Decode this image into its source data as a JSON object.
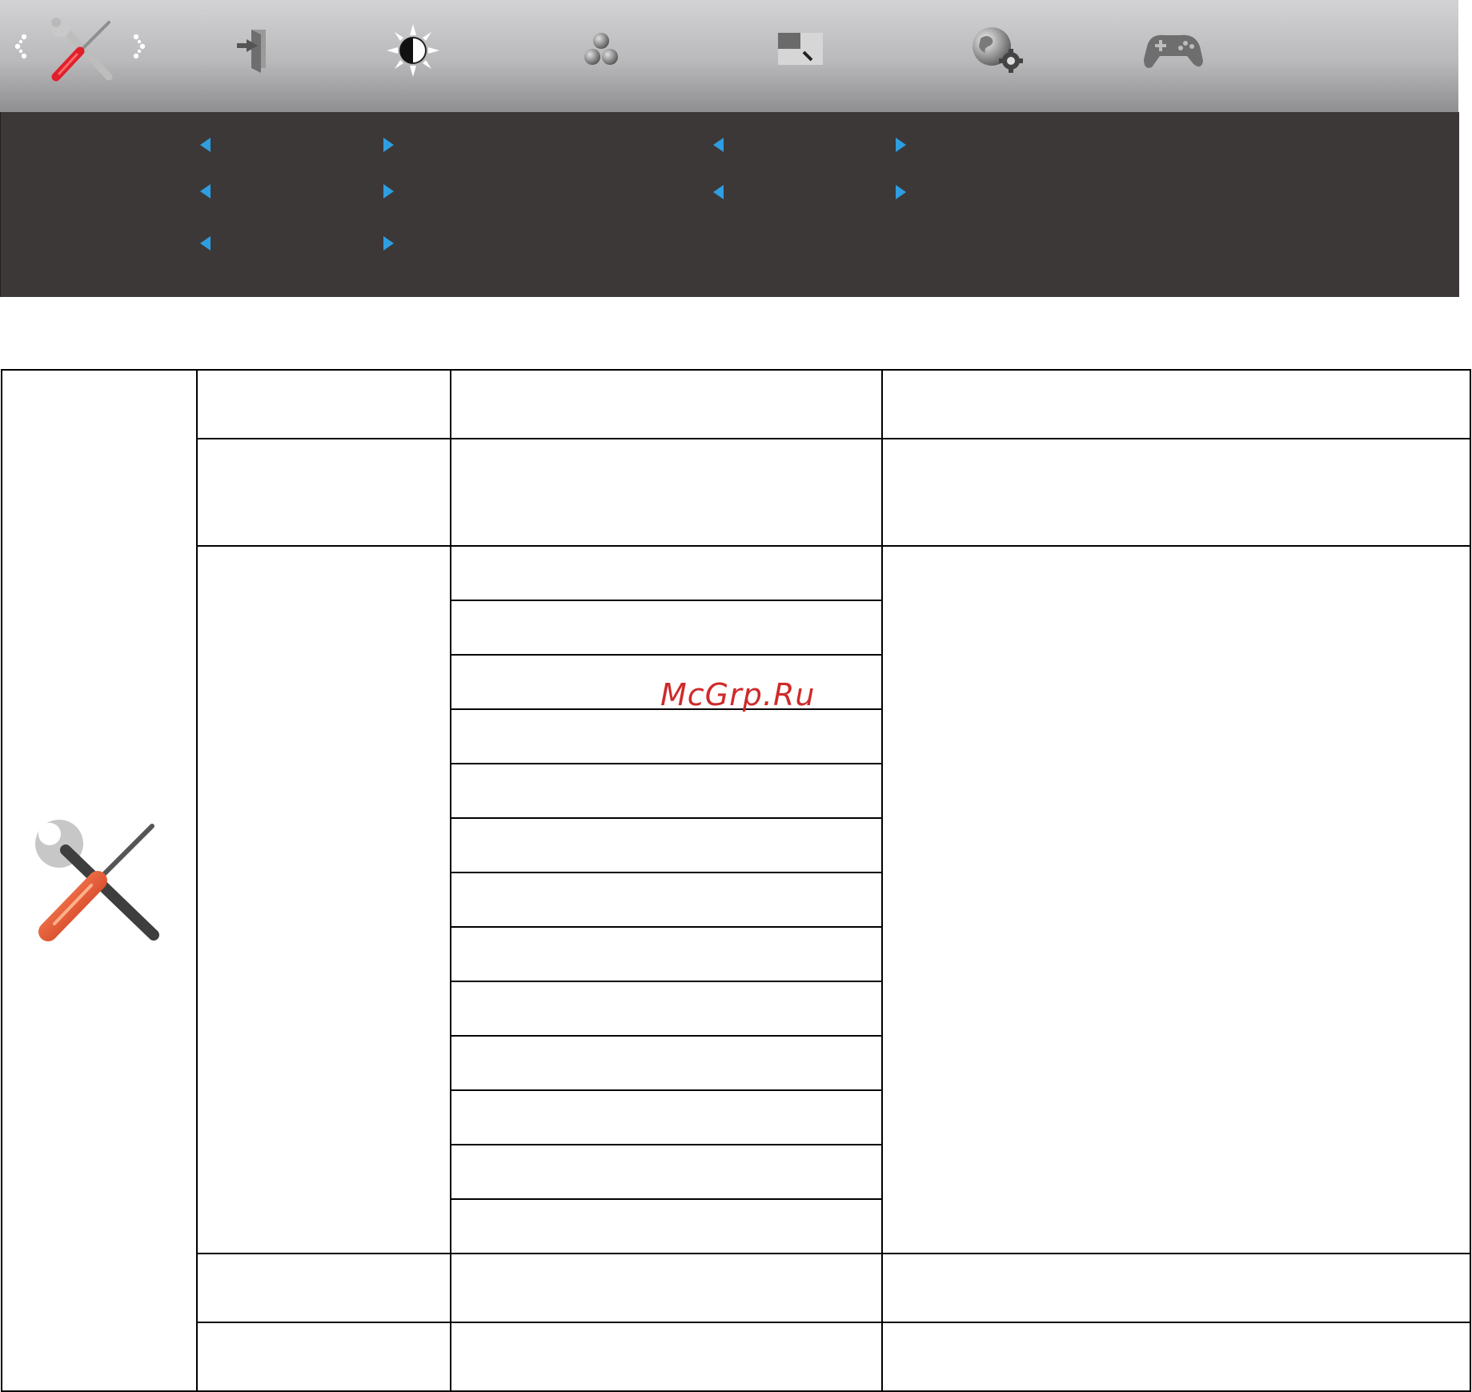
{
  "osd": {
    "tabs": [
      {
        "name": "extra",
        "icon": "tools-icon",
        "selected": true
      },
      {
        "name": "exit",
        "icon": "exit-icon"
      },
      {
        "name": "luminance",
        "icon": "brightness-icon"
      },
      {
        "name": "color-setup",
        "icon": "color-setup-icon"
      },
      {
        "name": "picture-boost",
        "icon": "picture-boost-icon"
      },
      {
        "name": "osd-setup",
        "icon": "osd-setup-icon"
      },
      {
        "name": "game-setting",
        "icon": "gamepad-icon"
      }
    ],
    "accent_color": "#2e9ee0"
  },
  "table": {
    "section_icon": "tools-icon"
  },
  "watermark": "McGrp.Ru"
}
